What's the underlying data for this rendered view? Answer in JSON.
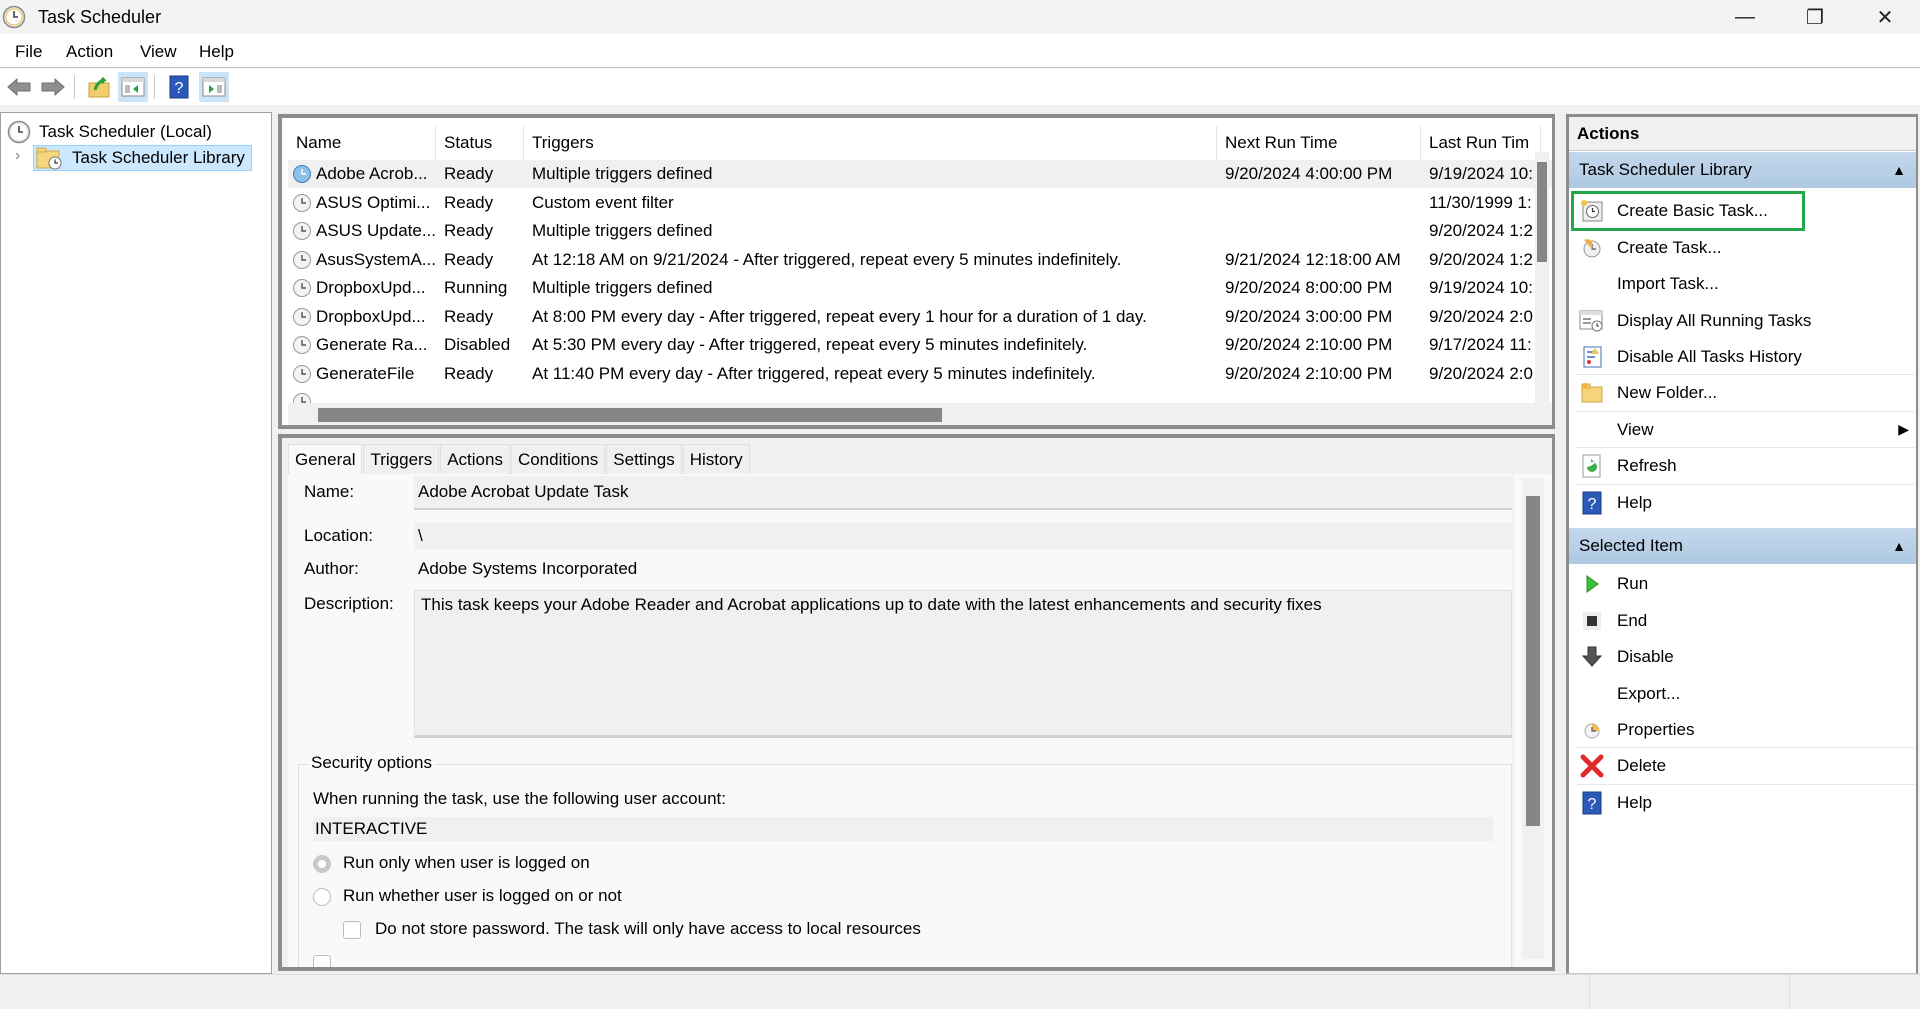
{
  "window": {
    "title": "Task Scheduler",
    "controls": {
      "minimize": "—",
      "restore": "❐",
      "close": "✕"
    }
  },
  "menu": [
    "File",
    "Action",
    "View",
    "Help"
  ],
  "toolbar": {
    "buttons": [
      "back-arrow-icon",
      "forward-arrow-icon",
      "up-folder-icon",
      "show-hide-console-tree-icon",
      "help-icon",
      "show-hide-action-pane-icon"
    ]
  },
  "tree": {
    "root": "Task Scheduler (Local)",
    "child": "Task Scheduler Library",
    "expander": "›"
  },
  "task_list": {
    "columns": [
      "Name",
      "Status",
      "Triggers",
      "Next Run Time",
      "Last Run Tim"
    ],
    "rows": [
      {
        "name": "Adobe Acrob...",
        "status": "Ready",
        "triggers": "Multiple triggers defined",
        "next_run": "9/20/2024 4:00:00 PM",
        "last_run": "9/19/2024 10:",
        "selected": true
      },
      {
        "name": "ASUS Optimi...",
        "status": "Ready",
        "triggers": "Custom event filter",
        "next_run": "",
        "last_run": "11/30/1999 1:"
      },
      {
        "name": "ASUS Update...",
        "status": "Ready",
        "triggers": "Multiple triggers defined",
        "next_run": "",
        "last_run": "9/20/2024 1:2"
      },
      {
        "name": "AsusSystemA...",
        "status": "Ready",
        "triggers": "At 12:18 AM on 9/21/2024 - After triggered, repeat every 5 minutes indefinitely.",
        "next_run": "9/21/2024 12:18:00 AM",
        "last_run": "9/20/2024 1:2"
      },
      {
        "name": "DropboxUpd...",
        "status": "Running",
        "triggers": "Multiple triggers defined",
        "next_run": "9/20/2024 8:00:00 PM",
        "last_run": "9/19/2024 10:"
      },
      {
        "name": "DropboxUpd...",
        "status": "Ready",
        "triggers": "At 8:00 PM every day - After triggered, repeat every 1 hour for a duration of 1 day.",
        "next_run": "9/20/2024 3:00:00 PM",
        "last_run": "9/20/2024 2:0"
      },
      {
        "name": "Generate Ra...",
        "status": "Disabled",
        "triggers": "At 5:30 PM every day - After triggered, repeat every 5 minutes indefinitely.",
        "next_run": "9/20/2024 2:10:00 PM",
        "last_run": "9/17/2024 11:"
      },
      {
        "name": "GenerateFile",
        "status": "Ready",
        "triggers": "At 11:40 PM every day - After triggered, repeat every 5 minutes indefinitely.",
        "next_run": "9/20/2024 2:10:00 PM",
        "last_run": "9/20/2024 2:0"
      }
    ]
  },
  "detail": {
    "tabs": [
      "General",
      "Triggers",
      "Actions",
      "Conditions",
      "Settings",
      "History"
    ],
    "active_tab": "General",
    "name_label": "Name:",
    "name_value": "Adobe Acrobat Update Task",
    "location_label": "Location:",
    "location_value": "\\",
    "author_label": "Author:",
    "author_value": "Adobe Systems Incorporated",
    "description_label": "Description:",
    "description_value": "This task keeps your Adobe Reader and Acrobat applications up to date with the latest enhancements and security fixes",
    "security": {
      "title": "Security options",
      "account_prompt": "When running the task, use the following user account:",
      "account_value": "INTERACTIVE",
      "radio_logged_on": "Run only when user is logged on",
      "radio_logged_on_checked": true,
      "radio_whether": "Run whether user is logged on or not",
      "radio_whether_checked": false,
      "no_store_password": "Do not store password.  The task will only have access to local resources",
      "no_store_password_checked": false
    }
  },
  "actions_pane": {
    "title": "Actions",
    "library_section": {
      "title": "Task Scheduler Library",
      "items": [
        {
          "label": "Create Basic Task...",
          "icon": "create-basic-task-icon"
        },
        {
          "label": "Create Task...",
          "icon": "create-task-icon"
        },
        {
          "label": "Import Task...",
          "icon": ""
        },
        {
          "label": "Display All Running Tasks",
          "icon": "running-tasks-icon"
        },
        {
          "label": "Disable All Tasks History",
          "icon": "tasks-history-icon"
        },
        {
          "label": "New Folder...",
          "icon": "new-folder-icon"
        },
        {
          "label": "View",
          "icon": "",
          "submenu": "▶"
        },
        {
          "label": "Refresh",
          "icon": "refresh-icon"
        },
        {
          "label": "Help",
          "icon": "help-icon"
        }
      ]
    },
    "selected_section": {
      "title": "Selected Item",
      "items": [
        {
          "label": "Run",
          "icon": "run-icon"
        },
        {
          "label": "End",
          "icon": "end-icon"
        },
        {
          "label": "Disable",
          "icon": "disable-icon"
        },
        {
          "label": "Export...",
          "icon": ""
        },
        {
          "label": "Properties",
          "icon": "properties-icon"
        },
        {
          "label": "Delete",
          "icon": "delete-icon"
        },
        {
          "label": "Help",
          "icon": "help-icon"
        }
      ]
    },
    "collapse_glyph": "▲",
    "highlight_color": "#22a84a"
  }
}
